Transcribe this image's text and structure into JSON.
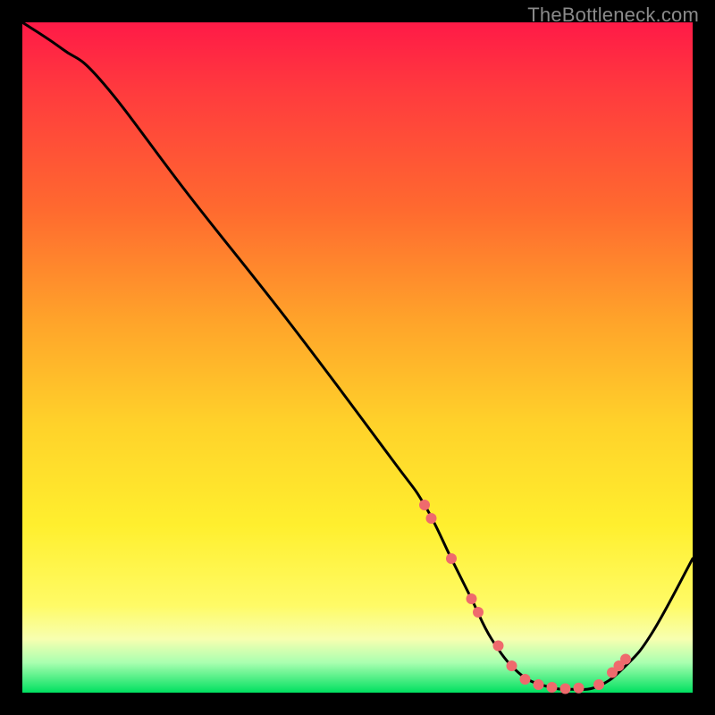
{
  "watermark": "TheBottleneck.com",
  "colors": {
    "background": "#000000",
    "curve_stroke": "#000000",
    "marker_fill": "#ef6a6d",
    "marker_stroke": "#ef6a6d"
  },
  "chart_data": {
    "type": "line",
    "title": "",
    "xlabel": "",
    "ylabel": "",
    "xlim": [
      0,
      100
    ],
    "ylim": [
      0,
      100
    ],
    "series": [
      {
        "name": "bottleneck-curve",
        "x": [
          0,
          6,
          12,
          25,
          40,
          55,
          60,
          64,
          67,
          70,
          74,
          78,
          82,
          86,
          90,
          94,
          100
        ],
        "y": [
          100,
          96,
          91,
          74,
          55,
          35,
          28,
          20,
          14,
          8,
          3,
          1,
          0.5,
          1,
          4,
          9,
          20
        ]
      }
    ],
    "markers": {
      "name": "highlight-dots",
      "x": [
        60,
        61,
        64,
        67,
        68,
        71,
        73,
        75,
        77,
        79,
        81,
        83,
        86,
        88,
        89,
        90
      ],
      "y": [
        28,
        26,
        20,
        14,
        12,
        7,
        4,
        2,
        1.2,
        0.8,
        0.6,
        0.7,
        1.2,
        3,
        4,
        5
      ]
    }
  }
}
